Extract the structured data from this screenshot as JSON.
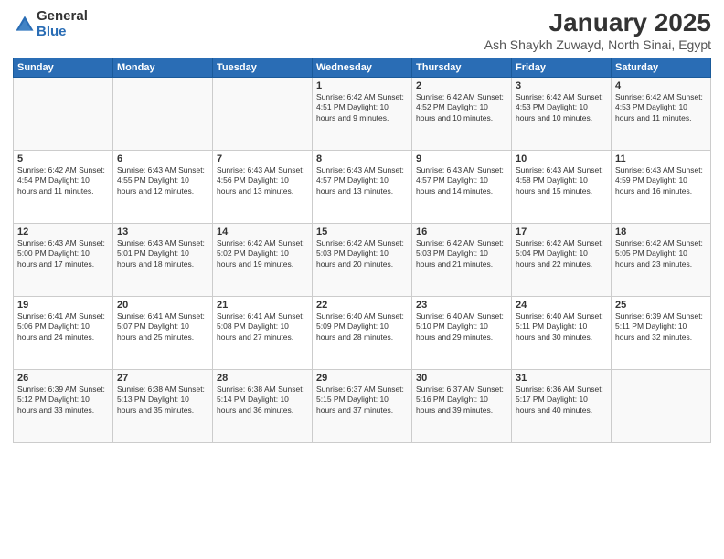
{
  "logo": {
    "general": "General",
    "blue": "Blue"
  },
  "title": "January 2025",
  "subtitle": "Ash Shaykh Zuwayd, North Sinai, Egypt",
  "headers": [
    "Sunday",
    "Monday",
    "Tuesday",
    "Wednesday",
    "Thursday",
    "Friday",
    "Saturday"
  ],
  "weeks": [
    [
      {
        "day": "",
        "info": ""
      },
      {
        "day": "",
        "info": ""
      },
      {
        "day": "",
        "info": ""
      },
      {
        "day": "1",
        "info": "Sunrise: 6:42 AM\nSunset: 4:51 PM\nDaylight: 10 hours\nand 9 minutes."
      },
      {
        "day": "2",
        "info": "Sunrise: 6:42 AM\nSunset: 4:52 PM\nDaylight: 10 hours\nand 10 minutes."
      },
      {
        "day": "3",
        "info": "Sunrise: 6:42 AM\nSunset: 4:53 PM\nDaylight: 10 hours\nand 10 minutes."
      },
      {
        "day": "4",
        "info": "Sunrise: 6:42 AM\nSunset: 4:53 PM\nDaylight: 10 hours\nand 11 minutes."
      }
    ],
    [
      {
        "day": "5",
        "info": "Sunrise: 6:42 AM\nSunset: 4:54 PM\nDaylight: 10 hours\nand 11 minutes."
      },
      {
        "day": "6",
        "info": "Sunrise: 6:43 AM\nSunset: 4:55 PM\nDaylight: 10 hours\nand 12 minutes."
      },
      {
        "day": "7",
        "info": "Sunrise: 6:43 AM\nSunset: 4:56 PM\nDaylight: 10 hours\nand 13 minutes."
      },
      {
        "day": "8",
        "info": "Sunrise: 6:43 AM\nSunset: 4:57 PM\nDaylight: 10 hours\nand 13 minutes."
      },
      {
        "day": "9",
        "info": "Sunrise: 6:43 AM\nSunset: 4:57 PM\nDaylight: 10 hours\nand 14 minutes."
      },
      {
        "day": "10",
        "info": "Sunrise: 6:43 AM\nSunset: 4:58 PM\nDaylight: 10 hours\nand 15 minutes."
      },
      {
        "day": "11",
        "info": "Sunrise: 6:43 AM\nSunset: 4:59 PM\nDaylight: 10 hours\nand 16 minutes."
      }
    ],
    [
      {
        "day": "12",
        "info": "Sunrise: 6:43 AM\nSunset: 5:00 PM\nDaylight: 10 hours\nand 17 minutes."
      },
      {
        "day": "13",
        "info": "Sunrise: 6:43 AM\nSunset: 5:01 PM\nDaylight: 10 hours\nand 18 minutes."
      },
      {
        "day": "14",
        "info": "Sunrise: 6:42 AM\nSunset: 5:02 PM\nDaylight: 10 hours\nand 19 minutes."
      },
      {
        "day": "15",
        "info": "Sunrise: 6:42 AM\nSunset: 5:03 PM\nDaylight: 10 hours\nand 20 minutes."
      },
      {
        "day": "16",
        "info": "Sunrise: 6:42 AM\nSunset: 5:03 PM\nDaylight: 10 hours\nand 21 minutes."
      },
      {
        "day": "17",
        "info": "Sunrise: 6:42 AM\nSunset: 5:04 PM\nDaylight: 10 hours\nand 22 minutes."
      },
      {
        "day": "18",
        "info": "Sunrise: 6:42 AM\nSunset: 5:05 PM\nDaylight: 10 hours\nand 23 minutes."
      }
    ],
    [
      {
        "day": "19",
        "info": "Sunrise: 6:41 AM\nSunset: 5:06 PM\nDaylight: 10 hours\nand 24 minutes."
      },
      {
        "day": "20",
        "info": "Sunrise: 6:41 AM\nSunset: 5:07 PM\nDaylight: 10 hours\nand 25 minutes."
      },
      {
        "day": "21",
        "info": "Sunrise: 6:41 AM\nSunset: 5:08 PM\nDaylight: 10 hours\nand 27 minutes."
      },
      {
        "day": "22",
        "info": "Sunrise: 6:40 AM\nSunset: 5:09 PM\nDaylight: 10 hours\nand 28 minutes."
      },
      {
        "day": "23",
        "info": "Sunrise: 6:40 AM\nSunset: 5:10 PM\nDaylight: 10 hours\nand 29 minutes."
      },
      {
        "day": "24",
        "info": "Sunrise: 6:40 AM\nSunset: 5:11 PM\nDaylight: 10 hours\nand 30 minutes."
      },
      {
        "day": "25",
        "info": "Sunrise: 6:39 AM\nSunset: 5:11 PM\nDaylight: 10 hours\nand 32 minutes."
      }
    ],
    [
      {
        "day": "26",
        "info": "Sunrise: 6:39 AM\nSunset: 5:12 PM\nDaylight: 10 hours\nand 33 minutes."
      },
      {
        "day": "27",
        "info": "Sunrise: 6:38 AM\nSunset: 5:13 PM\nDaylight: 10 hours\nand 35 minutes."
      },
      {
        "day": "28",
        "info": "Sunrise: 6:38 AM\nSunset: 5:14 PM\nDaylight: 10 hours\nand 36 minutes."
      },
      {
        "day": "29",
        "info": "Sunrise: 6:37 AM\nSunset: 5:15 PM\nDaylight: 10 hours\nand 37 minutes."
      },
      {
        "day": "30",
        "info": "Sunrise: 6:37 AM\nSunset: 5:16 PM\nDaylight: 10 hours\nand 39 minutes."
      },
      {
        "day": "31",
        "info": "Sunrise: 6:36 AM\nSunset: 5:17 PM\nDaylight: 10 hours\nand 40 minutes."
      },
      {
        "day": "",
        "info": ""
      }
    ]
  ]
}
